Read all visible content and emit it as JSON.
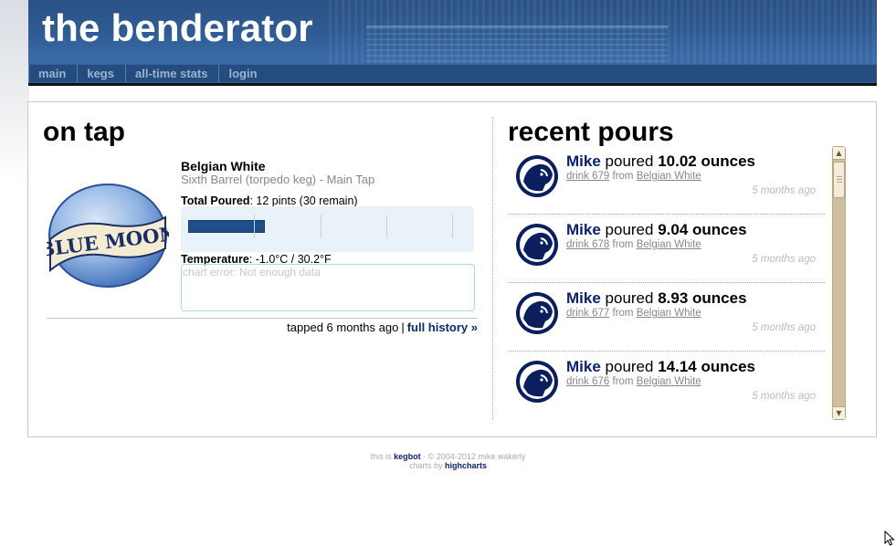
{
  "site": {
    "title": "the benderator"
  },
  "nav": {
    "items": [
      "main",
      "kegs",
      "all-time stats",
      "login"
    ]
  },
  "on_tap": {
    "heading": "on tap",
    "beer_name": "Belgian White",
    "keg_desc": "Sixth Barrel (torpedo keg) - Main Tap",
    "poured_label": "Total Poured",
    "poured_value": ": 12 pints (30 remain)",
    "keg_fraction_poured": 0.29,
    "temp_label": "Temperature",
    "temp_value": ": -1.0°C / 30.2°F",
    "chart_error": "chart error: Not enough data",
    "tapped": "tapped 6 months ago",
    "separator": "|",
    "full_history": "full history »",
    "logo_text": "BLUE MOON"
  },
  "recent": {
    "heading": "recent pours",
    "verb": "poured",
    "from_label": "from",
    "pours": [
      {
        "user": "Mike",
        "amount": "10.02 ounces",
        "drink": "drink 679",
        "beer": "Belgian White",
        "time": "5 months ago"
      },
      {
        "user": "Mike",
        "amount": "9.04 ounces",
        "drink": "drink 678",
        "beer": "Belgian White",
        "time": "5 months ago"
      },
      {
        "user": "Mike",
        "amount": "8.93 ounces",
        "drink": "drink 677",
        "beer": "Belgian White",
        "time": "5 months ago"
      },
      {
        "user": "Mike",
        "amount": "14.14 ounces",
        "drink": "drink 676",
        "beer": "Belgian White",
        "time": "5 months ago"
      }
    ]
  },
  "footer": {
    "line1_pre": "this is ",
    "line1_link": "kegbot",
    "line1_post": " · © 2004-2012 mike wakerly",
    "line2_pre": "charts by ",
    "line2_link": "highcharts"
  },
  "colors": {
    "banner": "#2f5c94",
    "nav": "#244c7f",
    "link": "#0b1f6e",
    "meter": "#1f4e8a"
  }
}
